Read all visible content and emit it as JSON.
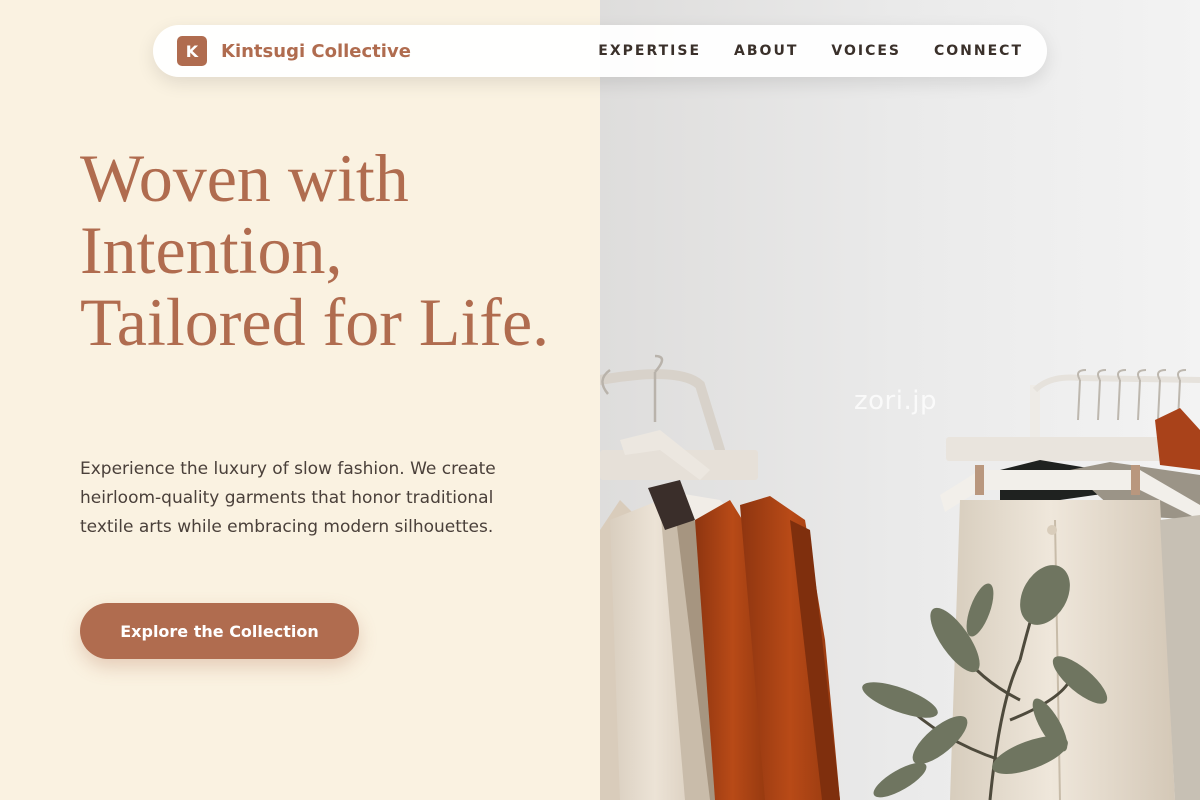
{
  "brand": {
    "logo_letter": "K",
    "name": "Kintsugi Collective"
  },
  "nav": {
    "items": [
      "EXPERTISE",
      "ABOUT",
      "VOICES",
      "CONNECT"
    ]
  },
  "hero": {
    "title": "Woven with Intention, Tailored for Life.",
    "description": "Experience the luxury of slow fashion. We create heirloom-quality garments that honor traditional textile arts while embracing modern silhouettes.",
    "cta_label": "Explore the Collection"
  },
  "image": {
    "watermark": "zori.jp"
  },
  "colors": {
    "accent": "#b06c4f",
    "background": "#faf2e1",
    "text_dark": "#3a302a"
  }
}
